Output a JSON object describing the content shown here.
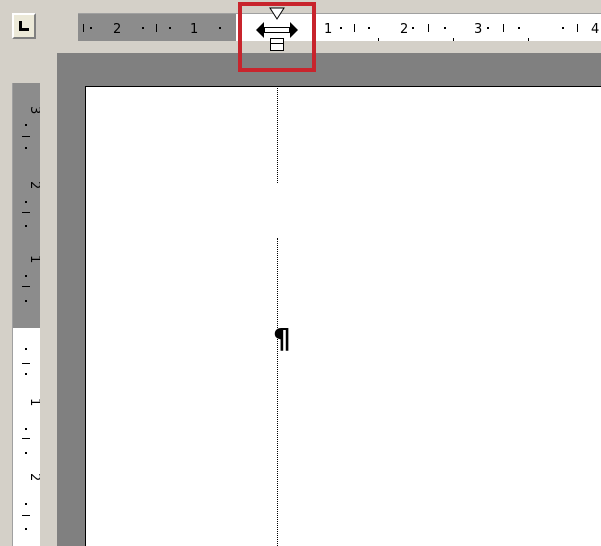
{
  "ruler": {
    "horizontal_labels": [
      "2",
      "1",
      "1",
      "2",
      "3",
      "4"
    ],
    "vertical_labels": [
      "3",
      "2",
      "1",
      "1",
      "2"
    ]
  },
  "tab_selector": {
    "icon": "left-tab-icon"
  },
  "indent_marker": {
    "icon": "column-resize-marker-icon",
    "highlight_color": "#c8242c"
  },
  "colors": {
    "workspace": "#808080",
    "ruler_margin": "#8c8c8c",
    "page": "#ffffff",
    "chrome": "#d4d0c8"
  },
  "document": {
    "paragraph_mark": "¶"
  }
}
